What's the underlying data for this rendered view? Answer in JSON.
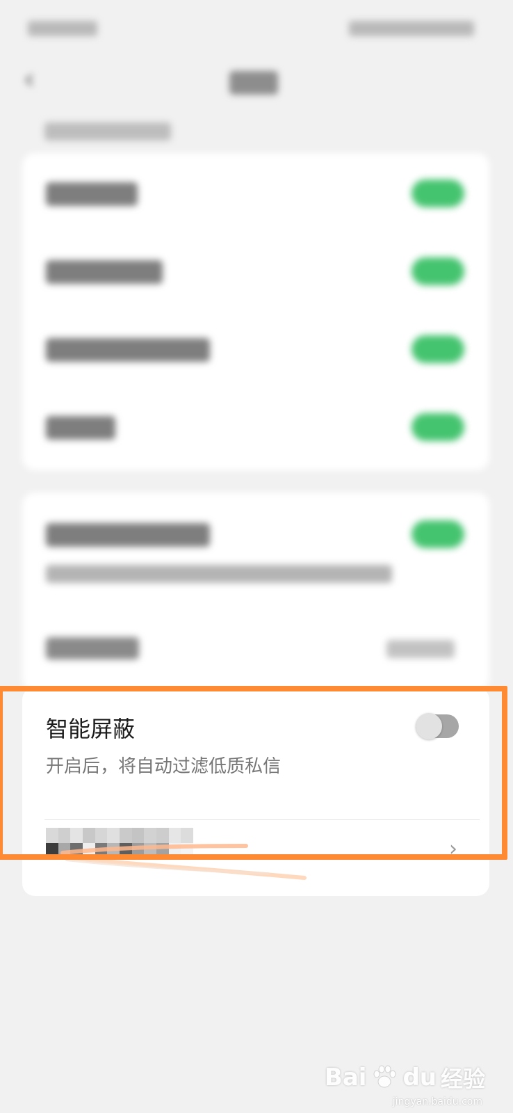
{
  "smart_block": {
    "title": "智能屏蔽",
    "description": "开启后，将自动过滤低质私信",
    "toggle_on": false
  },
  "icons": {
    "back": "‹",
    "chevron": "›"
  },
  "colors": {
    "toggle_on": "#45c46f",
    "toggle_off_track": "#a6a6a6",
    "highlight": "#ff8a34",
    "background": "#f1f1f1"
  },
  "watermark": {
    "brand": "Bai",
    "brand2": "du",
    "jingyan": "经验",
    "url": "jingyan.baidu.com"
  }
}
